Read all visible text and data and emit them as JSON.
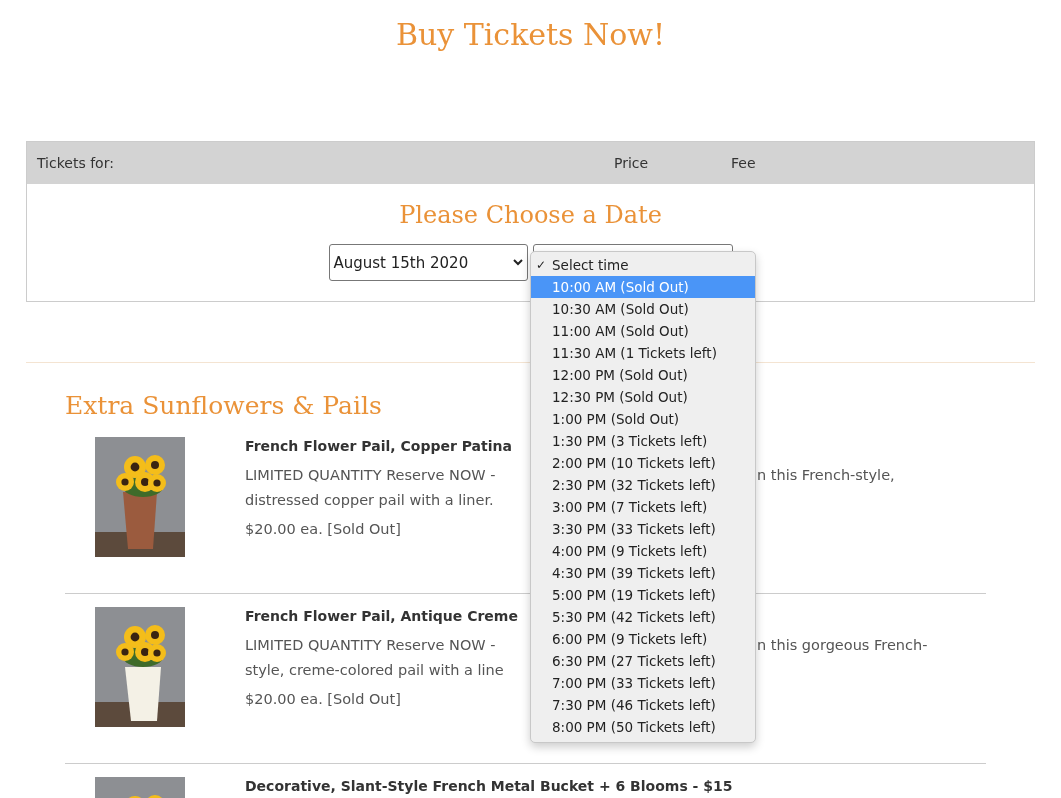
{
  "page_title": "Buy Tickets Now!",
  "ticket_table": {
    "columns": [
      "Tickets for:",
      "Price",
      "Fee"
    ],
    "heading": "Please Choose a Date",
    "date_select": {
      "value": "August 15th 2020"
    }
  },
  "time_dropdown": {
    "check_mark": "✓",
    "options": [
      {
        "label": "Select time",
        "selected": true,
        "highlighted": false
      },
      {
        "label": "10:00 AM (Sold Out)",
        "selected": false,
        "highlighted": true
      },
      {
        "label": "10:30 AM (Sold Out)",
        "selected": false,
        "highlighted": false
      },
      {
        "label": "11:00 AM (Sold Out)",
        "selected": false,
        "highlighted": false
      },
      {
        "label": "11:30 AM (1 Tickets left)",
        "selected": false,
        "highlighted": false
      },
      {
        "label": "12:00 PM (Sold Out)",
        "selected": false,
        "highlighted": false
      },
      {
        "label": "12:30 PM (Sold Out)",
        "selected": false,
        "highlighted": false
      },
      {
        "label": "1:00 PM (Sold Out)",
        "selected": false,
        "highlighted": false
      },
      {
        "label": "1:30 PM (3 Tickets left)",
        "selected": false,
        "highlighted": false
      },
      {
        "label": "2:00 PM (10 Tickets left)",
        "selected": false,
        "highlighted": false
      },
      {
        "label": "2:30 PM (32 Tickets left)",
        "selected": false,
        "highlighted": false
      },
      {
        "label": "3:00 PM (7 Tickets left)",
        "selected": false,
        "highlighted": false
      },
      {
        "label": "3:30 PM (33 Tickets left)",
        "selected": false,
        "highlighted": false
      },
      {
        "label": "4:00 PM (9 Tickets left)",
        "selected": false,
        "highlighted": false
      },
      {
        "label": "4:30 PM (39 Tickets left)",
        "selected": false,
        "highlighted": false
      },
      {
        "label": "5:00 PM (19 Tickets left)",
        "selected": false,
        "highlighted": false
      },
      {
        "label": "5:30 PM (42 Tickets left)",
        "selected": false,
        "highlighted": false
      },
      {
        "label": "6:00 PM (9 Tickets left)",
        "selected": false,
        "highlighted": false
      },
      {
        "label": "6:30 PM (27 Tickets left)",
        "selected": false,
        "highlighted": false
      },
      {
        "label": "7:00 PM (33 Tickets left)",
        "selected": false,
        "highlighted": false
      },
      {
        "label": "7:30 PM (46 Tickets left)",
        "selected": false,
        "highlighted": false
      },
      {
        "label": "8:00 PM (50 Tickets left)",
        "selected": false,
        "highlighted": false
      }
    ]
  },
  "section": {
    "title": "Extra Sunflowers & Pails",
    "products": [
      {
        "name": "French Flower Pail, Copper Patina",
        "description_line_1": "LIMITED QUANTITY Reserve NOW -",
        "description_line_1_end": "n this French-style,",
        "description_line_2": "distressed copper pail with a liner.",
        "price": "$20.00 ea. [Sold Out]"
      },
      {
        "name": "French Flower Pail, Antique Creme",
        "description_line_1": "LIMITED QUANTITY Reserve NOW -",
        "description_line_1_end": "n this gorgeous French-",
        "description_line_2": "style, creme-colored pail with a line",
        "price": "$20.00 ea. [Sold Out]"
      },
      {
        "name": "Decorative, Slant-Style French Metal Bucket + 6 Blooms - $15"
      }
    ]
  }
}
